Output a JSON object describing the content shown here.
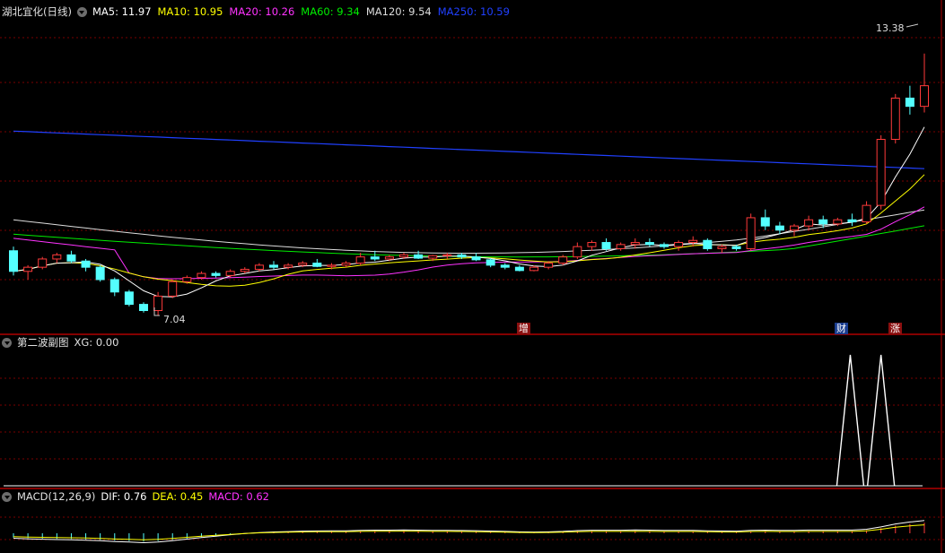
{
  "main_panel": {
    "title": "湖北宜化(日线)",
    "ma": [
      {
        "label": "MA5: 11.97",
        "color": "#ffffff"
      },
      {
        "label": "MA10: 10.95",
        "color": "#ffff00"
      },
      {
        "label": "MA20: 10.26",
        "color": "#ff33ff"
      },
      {
        "label": "MA60: 9.34",
        "color": "#00ee00"
      },
      {
        "label": "MA120: 9.54",
        "color": "#dddddd"
      },
      {
        "label": "MA250: 10.59",
        "color": "#2040ff"
      }
    ],
    "high_label": "13.38",
    "low_label": "7.04",
    "markers": [
      {
        "text": "增",
        "bg": "#8b1010"
      },
      {
        "text": "财",
        "bg": "#1a3d8f"
      },
      {
        "text": "涨",
        "bg": "#8b1010"
      }
    ]
  },
  "sub_panel": {
    "title": "第二波副图",
    "value_label": "XG: 0.00"
  },
  "macd_panel": {
    "title": "MACD(12,26,9)",
    "dif": "DIF: 0.76",
    "dea": "DEA: 0.45",
    "macd": "MACD: 0.62"
  },
  "colors": {
    "up": "#ff3a3a",
    "down": "#54ffff",
    "grid": "#7a0000",
    "separator": "#b00000",
    "dif": "#ffffff",
    "dea": "#ffff00",
    "macd": "#ff33ff",
    "ma250": "#2040ff",
    "ma120": "#dddddd",
    "ma60": "#00ee00",
    "ma20": "#ff33ff",
    "ma10": "#ffff00",
    "ma5": "#ffffff"
  },
  "chart_data": {
    "type": "candlestick",
    "title": "湖北宜化(日线)",
    "candles": [
      [
        8.6,
        8.7,
        8.0,
        8.1
      ],
      [
        8.1,
        8.25,
        7.9,
        8.2
      ],
      [
        8.2,
        8.45,
        8.15,
        8.4
      ],
      [
        8.4,
        8.55,
        8.3,
        8.5
      ],
      [
        8.5,
        8.6,
        8.3,
        8.35
      ],
      [
        8.35,
        8.4,
        8.1,
        8.2
      ],
      [
        8.2,
        8.25,
        7.85,
        7.9
      ],
      [
        7.9,
        7.95,
        7.5,
        7.6
      ],
      [
        7.6,
        7.65,
        7.25,
        7.3
      ],
      [
        7.3,
        7.35,
        7.1,
        7.15
      ],
      [
        7.15,
        7.6,
        7.04,
        7.5
      ],
      [
        7.5,
        7.9,
        7.45,
        7.85
      ],
      [
        7.85,
        8.0,
        7.8,
        7.95
      ],
      [
        7.95,
        8.1,
        7.9,
        8.05
      ],
      [
        8.05,
        8.1,
        7.95,
        8.0
      ],
      [
        8.0,
        8.15,
        7.95,
        8.1
      ],
      [
        8.1,
        8.2,
        8.05,
        8.15
      ],
      [
        8.15,
        8.3,
        8.1,
        8.25
      ],
      [
        8.25,
        8.35,
        8.15,
        8.2
      ],
      [
        8.2,
        8.3,
        8.15,
        8.25
      ],
      [
        8.25,
        8.35,
        8.2,
        8.3
      ],
      [
        8.3,
        8.4,
        8.2,
        8.22
      ],
      [
        8.22,
        8.3,
        8.15,
        8.25
      ],
      [
        8.25,
        8.35,
        8.2,
        8.3
      ],
      [
        8.3,
        8.55,
        8.25,
        8.45
      ],
      [
        8.45,
        8.6,
        8.35,
        8.4
      ],
      [
        8.4,
        8.5,
        8.35,
        8.45
      ],
      [
        8.45,
        8.55,
        8.4,
        8.5
      ],
      [
        8.5,
        8.6,
        8.4,
        8.42
      ],
      [
        8.42,
        8.5,
        8.35,
        8.48
      ],
      [
        8.48,
        8.55,
        8.4,
        8.5
      ],
      [
        8.5,
        8.55,
        8.4,
        8.45
      ],
      [
        8.45,
        8.55,
        8.35,
        8.38
      ],
      [
        8.38,
        8.42,
        8.2,
        8.25
      ],
      [
        8.25,
        8.3,
        8.15,
        8.2
      ],
      [
        8.2,
        8.25,
        8.1,
        8.12
      ],
      [
        8.12,
        8.25,
        8.1,
        8.2
      ],
      [
        8.2,
        8.35,
        8.15,
        8.3
      ],
      [
        8.3,
        8.5,
        8.25,
        8.45
      ],
      [
        8.45,
        8.8,
        8.4,
        8.7
      ],
      [
        8.7,
        8.85,
        8.6,
        8.8
      ],
      [
        8.8,
        8.9,
        8.6,
        8.65
      ],
      [
        8.65,
        8.8,
        8.6,
        8.75
      ],
      [
        8.75,
        8.9,
        8.65,
        8.8
      ],
      [
        8.8,
        8.9,
        8.7,
        8.75
      ],
      [
        8.75,
        8.8,
        8.65,
        8.7
      ],
      [
        8.7,
        8.85,
        8.6,
        8.8
      ],
      [
        8.8,
        8.95,
        8.7,
        8.85
      ],
      [
        8.85,
        8.9,
        8.6,
        8.65
      ],
      [
        8.65,
        8.75,
        8.55,
        8.7
      ],
      [
        8.7,
        8.75,
        8.6,
        8.65
      ],
      [
        8.65,
        9.5,
        8.6,
        9.4
      ],
      [
        9.4,
        9.6,
        9.1,
        9.2
      ],
      [
        9.2,
        9.3,
        9.0,
        9.1
      ],
      [
        9.1,
        9.25,
        8.95,
        9.2
      ],
      [
        9.2,
        9.45,
        9.1,
        9.35
      ],
      [
        9.35,
        9.45,
        9.15,
        9.25
      ],
      [
        9.25,
        9.4,
        9.2,
        9.35
      ],
      [
        9.35,
        9.5,
        9.2,
        9.3
      ],
      [
        9.3,
        9.8,
        9.25,
        9.7
      ],
      [
        9.7,
        11.4,
        9.6,
        11.3
      ],
      [
        11.3,
        12.4,
        11.2,
        12.3
      ],
      [
        12.3,
        12.6,
        11.9,
        12.1
      ],
      [
        12.1,
        13.38,
        11.95,
        12.6
      ]
    ],
    "high": 13.38,
    "low": 7.04,
    "macd_bars": [
      -0.25,
      -0.28,
      -0.3,
      -0.32,
      -0.33,
      -0.35,
      -0.38,
      -0.42,
      -0.45,
      -0.48,
      -0.45,
      -0.38,
      -0.3,
      -0.22,
      -0.15,
      -0.08,
      -0.02,
      0.03,
      0.06,
      0.08,
      0.1,
      0.11,
      0.12,
      0.12,
      0.14,
      0.15,
      0.15,
      0.16,
      0.15,
      0.14,
      0.14,
      0.13,
      0.12,
      0.1,
      0.08,
      0.06,
      0.05,
      0.06,
      0.08,
      0.12,
      0.14,
      0.14,
      0.14,
      0.15,
      0.14,
      0.13,
      0.13,
      0.13,
      0.11,
      0.1,
      0.09,
      0.13,
      0.14,
      0.13,
      0.13,
      0.14,
      0.14,
      0.14,
      0.14,
      0.18,
      0.3,
      0.45,
      0.55,
      0.62
    ],
    "xg_spikes": [
      58,
      60
    ]
  }
}
